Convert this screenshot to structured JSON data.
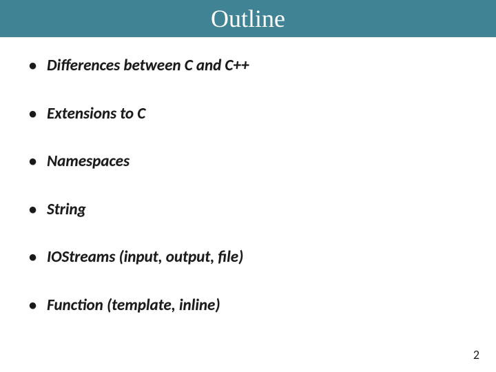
{
  "title": "Outline",
  "bullets": [
    "Differences between C and C++",
    "Extensions to C",
    "Namespaces",
    "String",
    "IOStreams (input, output, file)",
    "Function (template, inline)"
  ],
  "page_number": "2",
  "colors": {
    "accent": "#3f8395"
  }
}
